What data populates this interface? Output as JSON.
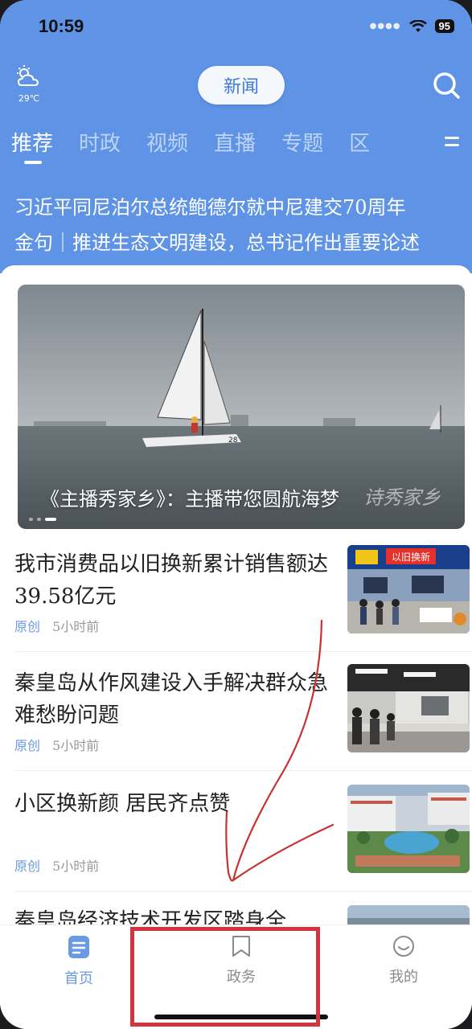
{
  "status_bar": {
    "time": "10:59",
    "battery": "95"
  },
  "header": {
    "weather_temp": "29℃",
    "title": "新闻"
  },
  "tabs": [
    {
      "label": "推荐",
      "active": true
    },
    {
      "label": "时政",
      "active": false
    },
    {
      "label": "视频",
      "active": false
    },
    {
      "label": "直播",
      "active": false
    },
    {
      "label": "专题",
      "active": false
    },
    {
      "label": "区",
      "active": false
    }
  ],
  "ticker": [
    "习近平同尼泊尔总统鲍德尔就中尼建交70周年",
    "金句｜推进生态文明建设，总书记作出重要论述"
  ],
  "hero": {
    "caption": "《主播秀家乡》：主播带您圆航海梦",
    "watermark": "诗秀家乡",
    "sail_text": "28"
  },
  "news": [
    {
      "title": "我市消费品以旧换新累计销售额达39.58亿元",
      "tag": "原创",
      "time": "5小时前",
      "thumb_text": "以旧换新"
    },
    {
      "title": "秦皇岛从作风建设入手解决群众急难愁盼问题",
      "tag": "原创",
      "time": "5小时前"
    },
    {
      "title": "小区换新颜 居民齐点赞",
      "tag": "原创",
      "time": "5小时前"
    },
    {
      "title": "秦皇岛经济技术开发区踏身全"
    }
  ],
  "bottom_nav": [
    {
      "label": "首页",
      "active": true
    },
    {
      "label": "政务",
      "active": false
    },
    {
      "label": "我的",
      "active": false
    }
  ],
  "colors": {
    "header_blue": "#5e93e6",
    "accent": "#3f78d8",
    "tag_blue": "#6a9ae0",
    "highlight_red": "#d2353e",
    "annotation_red": "#c8322f"
  }
}
